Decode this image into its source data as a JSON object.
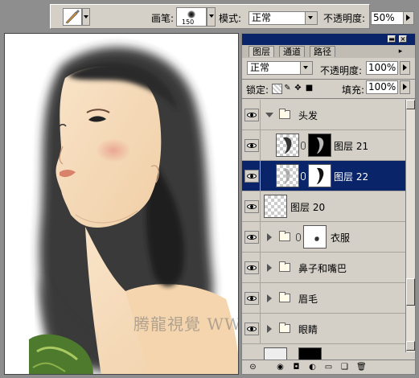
{
  "options_bar": {
    "brush_label": "画笔:",
    "brush_size": "150",
    "mode_label": "模式:",
    "mode_value": "正常",
    "opacity_label": "不透明度:",
    "opacity_value": "50%"
  },
  "canvas": {
    "watermark": "腾龍視覺 WWW.TLVI.NET"
  },
  "layers_panel": {
    "tabs": [
      "图层",
      "通道",
      "路径"
    ],
    "active_tab": "图层",
    "blend_mode": "正常",
    "opacity_label": "不透明度:",
    "opacity_value": "100%",
    "lock_label": "锁定:",
    "fill_label": "填充:",
    "fill_value": "100%",
    "layers": [
      {
        "name": "头发",
        "kind": "group",
        "expanded": true
      },
      {
        "name": "图层 21",
        "kind": "layer-with-mask"
      },
      {
        "name": "图层 22",
        "kind": "layer-with-mask",
        "selected": true
      },
      {
        "name": "图层 20",
        "kind": "layer"
      },
      {
        "name": "衣服",
        "kind": "group-with-mask"
      },
      {
        "name": "鼻子和嘴巴",
        "kind": "group"
      },
      {
        "name": "眉毛",
        "kind": "group"
      },
      {
        "name": "眼睛",
        "kind": "group"
      }
    ]
  },
  "colors": {
    "ui_gray": "#d4d0c8",
    "selection": "#0a246a",
    "titlebar": "#0a246a"
  },
  "icons": {
    "brush_tool": "brush-icon",
    "eye": "eye-icon",
    "folder": "folder-icon",
    "chain": "chain-link-icon"
  }
}
